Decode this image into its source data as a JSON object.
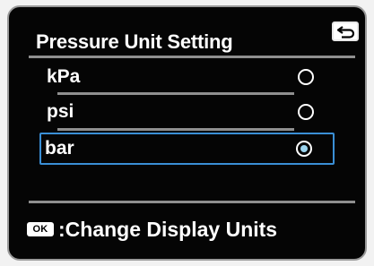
{
  "screen": {
    "title": "Pressure Unit Setting",
    "back_icon": "return-arrow-icon"
  },
  "options": [
    {
      "label": "kPa",
      "selected": false
    },
    {
      "label": "psi",
      "selected": false
    },
    {
      "label": "bar",
      "selected": true
    }
  ],
  "footer": {
    "ok_label": "OK",
    "hint": ":Change Display Units"
  },
  "colors": {
    "background": "#050505",
    "text": "#ffffff",
    "highlight_border": "#3a8fd6",
    "radio_fill": "#9ad3ee",
    "divider": "#8f8f8f"
  }
}
